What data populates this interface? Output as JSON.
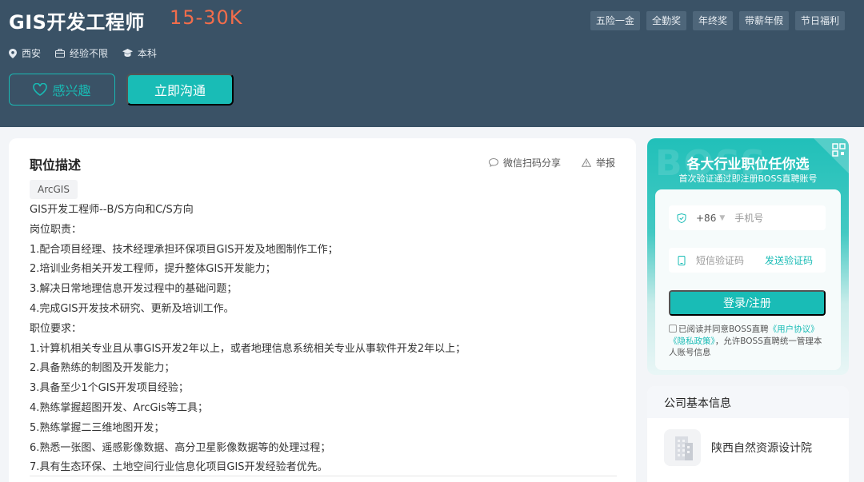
{
  "header": {
    "job_title": "GIS开发工程师",
    "salary": "15-30K",
    "benefits": [
      "五险一金",
      "全勤奖",
      "年终奖",
      "带薪年假",
      "节日福利"
    ],
    "location": "西安",
    "experience": "经验不限",
    "education": "本科",
    "fav_label": "感兴趣",
    "chat_label": "立即沟通"
  },
  "main": {
    "section_title": "职位描述",
    "share_label": "微信扫码分享",
    "report_label": "举报",
    "tag": "ArcGIS",
    "description": [
      "GIS开发工程师--B/S方向和C/S方向",
      "岗位职责：",
      "1.配合项目经理、技术经理承担环保项目GIS开发及地图制作工作；",
      "2.培训业务相关开发工程师，提升整体GIS开发能力；",
      "3.解决日常地理信息开发过程中的基础问题；",
      "4.完成GIS开发技术研究、更新及培训工作。",
      "职位要求：",
      "1.计算机相关专业且从事GIS开发2年以上，或者地理信息系统相关专业从事软件开发2年以上；",
      "2.具备熟练的制图及开发能力；",
      "3.具备至少1个GIS开发项目经验；",
      "4.熟练掌握超图开发、ArcGis等工具；",
      "5.熟练掌握二三维地图开发；",
      "6.熟悉一张图、遥感影像数据、高分卫星影像数据等的处理过程；",
      "7.具有生态环保、土地空间行业信息化项目GIS开发经验者优先。"
    ]
  },
  "login": {
    "bg_text": "BOSS",
    "title": "各大行业职位任你选",
    "subtitle": "首次验证通过即注册BOSS直聘账号",
    "country_code": "+86",
    "phone_placeholder": "手机号",
    "code_placeholder": "短信验证码",
    "send_code": "发送验证码",
    "login_button": "登录/注册",
    "agree_prefix": "已阅读并同意BOSS直聘",
    "agree_link1": "《用户协议》",
    "agree_link2": "《隐私政策》",
    "agree_suffix": "，允许BOSS直聘统一管理本人账号信息"
  },
  "company": {
    "section_title": "公司基本信息",
    "name": "陕西自然资源设计院"
  },
  "colors": {
    "header_bg": "#3a5266",
    "accent": "#19bcb6",
    "salary": "#f26d4b"
  }
}
